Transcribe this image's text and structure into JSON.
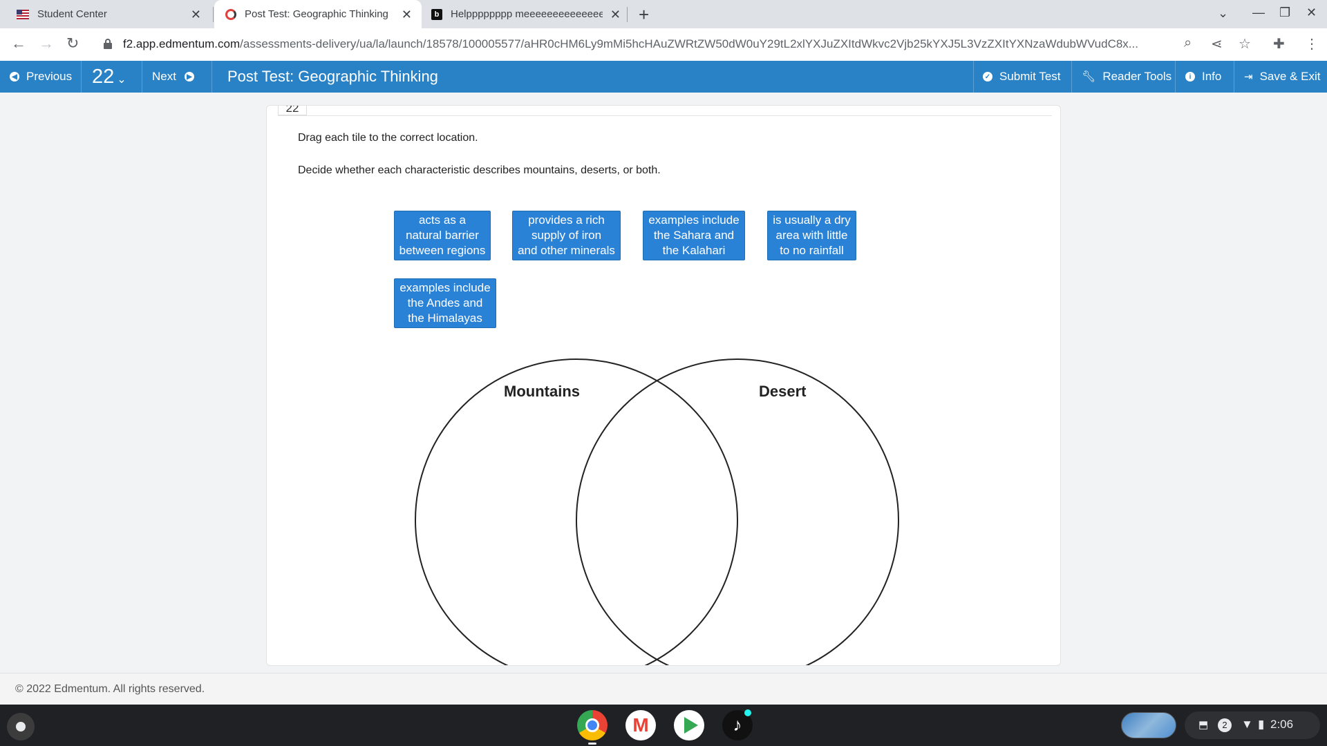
{
  "browser": {
    "tabs": [
      {
        "title": "Student Center"
      },
      {
        "title": "Post Test: Geographic Thinking"
      },
      {
        "title": "Helpppppppp meeeeeeeeeeeeeeeeeeeee"
      }
    ],
    "url_host": "f2.app.edmentum.com",
    "url_path": "/assessments-delivery/ua/la/launch/18578/100005577/aHR0cHM6Ly9mMi5hcHAuZWRtZW50dW0uY29tL2xlYXJuZXItdWkvc2Vjb25kYXJ5L3VzZXItYXNzaWdubWVudC8x..."
  },
  "header": {
    "previous_label": "Previous",
    "question_number": "22",
    "next_label": "Next",
    "title": "Post Test: Geographic Thinking",
    "submit_label": "Submit Test",
    "reader_tools_label": "Reader Tools",
    "info_label": "Info",
    "save_exit_label": "Save & Exit"
  },
  "question": {
    "number": "22",
    "instruction_1": "Drag each tile to the correct location.",
    "instruction_2": "Decide whether each characteristic describes mountains, deserts, or both.",
    "tiles": [
      {
        "line1": "acts as a",
        "line2": "natural barrier",
        "line3": "between regions"
      },
      {
        "line1": "provides a rich",
        "line2": "supply of iron",
        "line3": "and other minerals"
      },
      {
        "line1": "examples include",
        "line2": "the Sahara and",
        "line3": "the Kalahari"
      },
      {
        "line1": "is usually a dry",
        "line2": "area with little",
        "line3": "to no rainfall"
      },
      {
        "line1": "examples include",
        "line2": "the Andes and",
        "line3": "the Himalayas"
      }
    ],
    "venn": {
      "left_label": "Mountains",
      "right_label": "Desert"
    }
  },
  "footer": {
    "copyright": "© 2022 Edmentum. All rights reserved."
  },
  "shelf": {
    "notification_count": "2",
    "time": "2:06"
  },
  "colors": {
    "header_blue": "#2a82c6",
    "tile_blue": "#2a82d6",
    "shelf_dark": "#202124"
  }
}
